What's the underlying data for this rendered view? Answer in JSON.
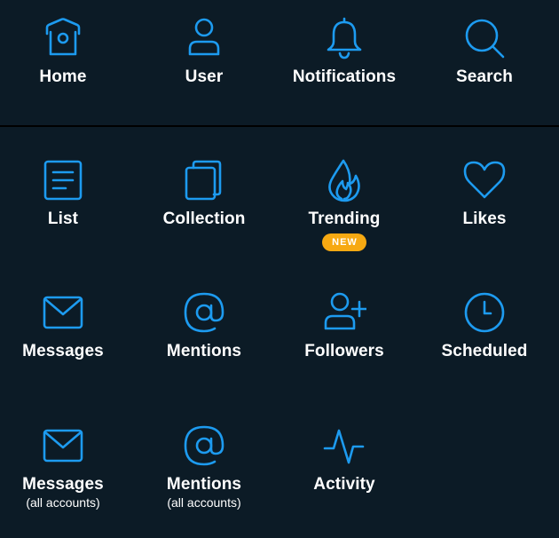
{
  "top": {
    "items": [
      {
        "label": "Home",
        "icon": "home-icon"
      },
      {
        "label": "User",
        "icon": "user-icon"
      },
      {
        "label": "Notifications",
        "icon": "bell-icon"
      },
      {
        "label": "Search",
        "icon": "search-icon"
      }
    ]
  },
  "grid": {
    "items": [
      {
        "label": "List",
        "icon": "list-icon"
      },
      {
        "label": "Collection",
        "icon": "collection-icon"
      },
      {
        "label": "Trending",
        "icon": "flame-icon",
        "badge": "NEW"
      },
      {
        "label": "Likes",
        "icon": "heart-icon"
      },
      {
        "label": "Messages",
        "icon": "envelope-icon"
      },
      {
        "label": "Mentions",
        "icon": "at-icon"
      },
      {
        "label": "Followers",
        "icon": "add-user-icon"
      },
      {
        "label": "Scheduled",
        "icon": "clock-icon"
      },
      {
        "label": "Messages",
        "sublabel": "(all accounts)",
        "icon": "envelope-icon"
      },
      {
        "label": "Mentions",
        "sublabel": "(all accounts)",
        "icon": "at-icon"
      },
      {
        "label": "Activity",
        "icon": "activity-icon"
      }
    ]
  },
  "colors": {
    "background": "#0c1b26",
    "accent": "#1d9bf0",
    "badge": "#f7a912",
    "text": "#ffffff"
  }
}
